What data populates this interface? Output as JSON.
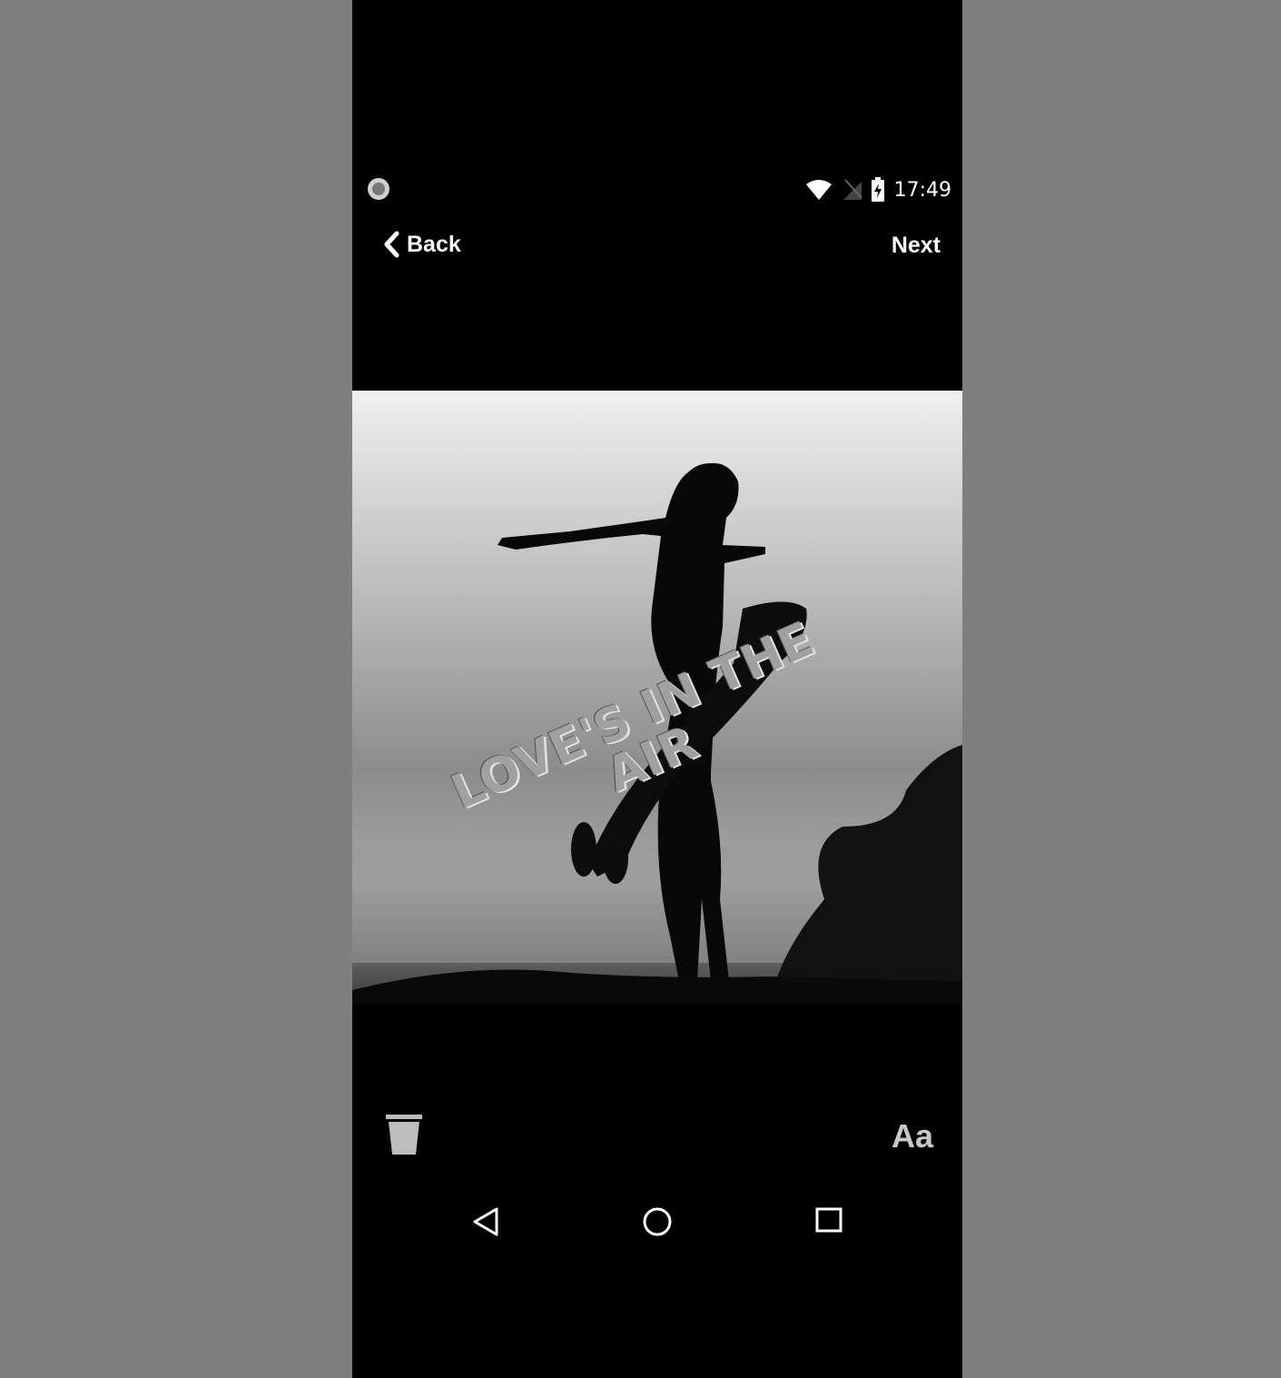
{
  "status_bar": {
    "time": "17:49",
    "icons": [
      "record-indicator-icon",
      "wifi-icon",
      "no-sim-icon",
      "battery-charging-icon"
    ]
  },
  "header": {
    "back_label": "Back",
    "next_label": "Next"
  },
  "editor": {
    "overlay_text_line1": "LOVE'S IN THE",
    "overlay_text_line2": "AIR"
  },
  "toolbar": {
    "delete_icon": "trash-icon",
    "font_label": "Aa"
  },
  "system_nav": {
    "icons": [
      "nav-back-icon",
      "nav-home-icon",
      "nav-recents-icon"
    ]
  },
  "colors": {
    "background": "#7f7f7f",
    "screen": "#000000",
    "text": "#ffffff",
    "overlay_text": "#a0a0a0"
  }
}
